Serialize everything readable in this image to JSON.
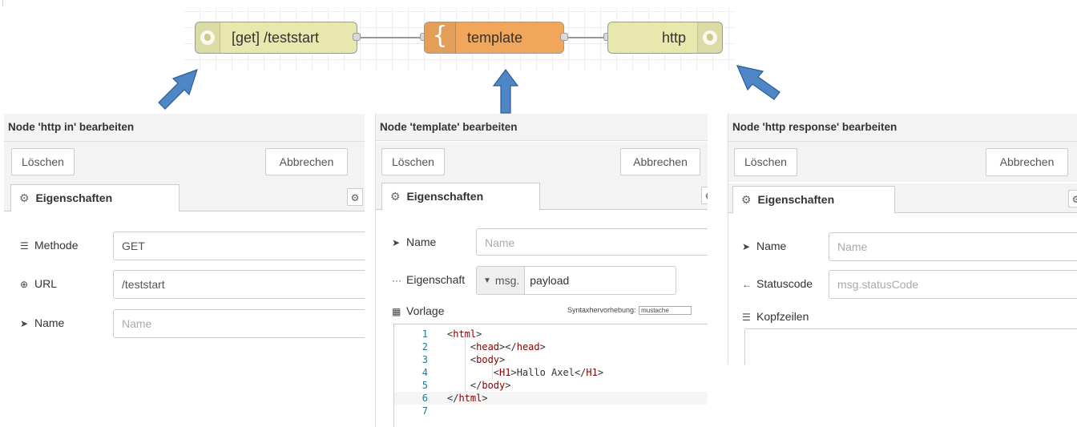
{
  "flow": {
    "nodes": {
      "http_in": {
        "label": "[get] /teststart",
        "icon": "globe-icon",
        "color": "#e7e7ae"
      },
      "template": {
        "label": "template",
        "icon": "curly-brace-icon",
        "color": "#f0a75c"
      },
      "http_response": {
        "label": "http",
        "icon": "globe-icon",
        "color": "#e7e7ae"
      }
    }
  },
  "panel_http_in": {
    "title": "Node 'http in' bearbeiten",
    "delete_label": "Löschen",
    "cancel_label": "Abbrechen",
    "tab_label": "Eigenschaften",
    "method_label": "Methode",
    "method_value": "GET",
    "url_label": "URL",
    "url_value": "/teststart",
    "name_label": "Name",
    "name_placeholder": "Name"
  },
  "panel_template": {
    "title": "Node 'template' bearbeiten",
    "delete_label": "Löschen",
    "cancel_label": "Abbrechen",
    "tab_label": "Eigenschaften",
    "name_label": "Name",
    "name_placeholder": "Name",
    "property_label": "Eigenschaft",
    "property_type": "msg.",
    "property_value": "payload",
    "template_label": "Vorlage",
    "syntax_label": "Syntaxhervorhebung:",
    "syntax_value": "mustache",
    "code_lines": [
      {
        "num": "1",
        "text": "<html>"
      },
      {
        "num": "2",
        "text": "    <head></head>"
      },
      {
        "num": "3",
        "text": "    <body>"
      },
      {
        "num": "4",
        "text": "        <H1>Hallo Axel</H1>"
      },
      {
        "num": "5",
        "text": "    </body>"
      },
      {
        "num": "6",
        "text": "</html>"
      },
      {
        "num": "7",
        "text": ""
      }
    ]
  },
  "panel_http_response": {
    "title": "Node 'http response' bearbeiten",
    "delete_label": "Löschen",
    "cancel_label": "Abbrechen",
    "tab_label": "Eigenschaften",
    "name_label": "Name",
    "name_placeholder": "Name",
    "status_label": "Statuscode",
    "status_placeholder": "msg.statusCode",
    "headers_label": "Kopfzeilen"
  },
  "arrow_color": "#4f86c6"
}
